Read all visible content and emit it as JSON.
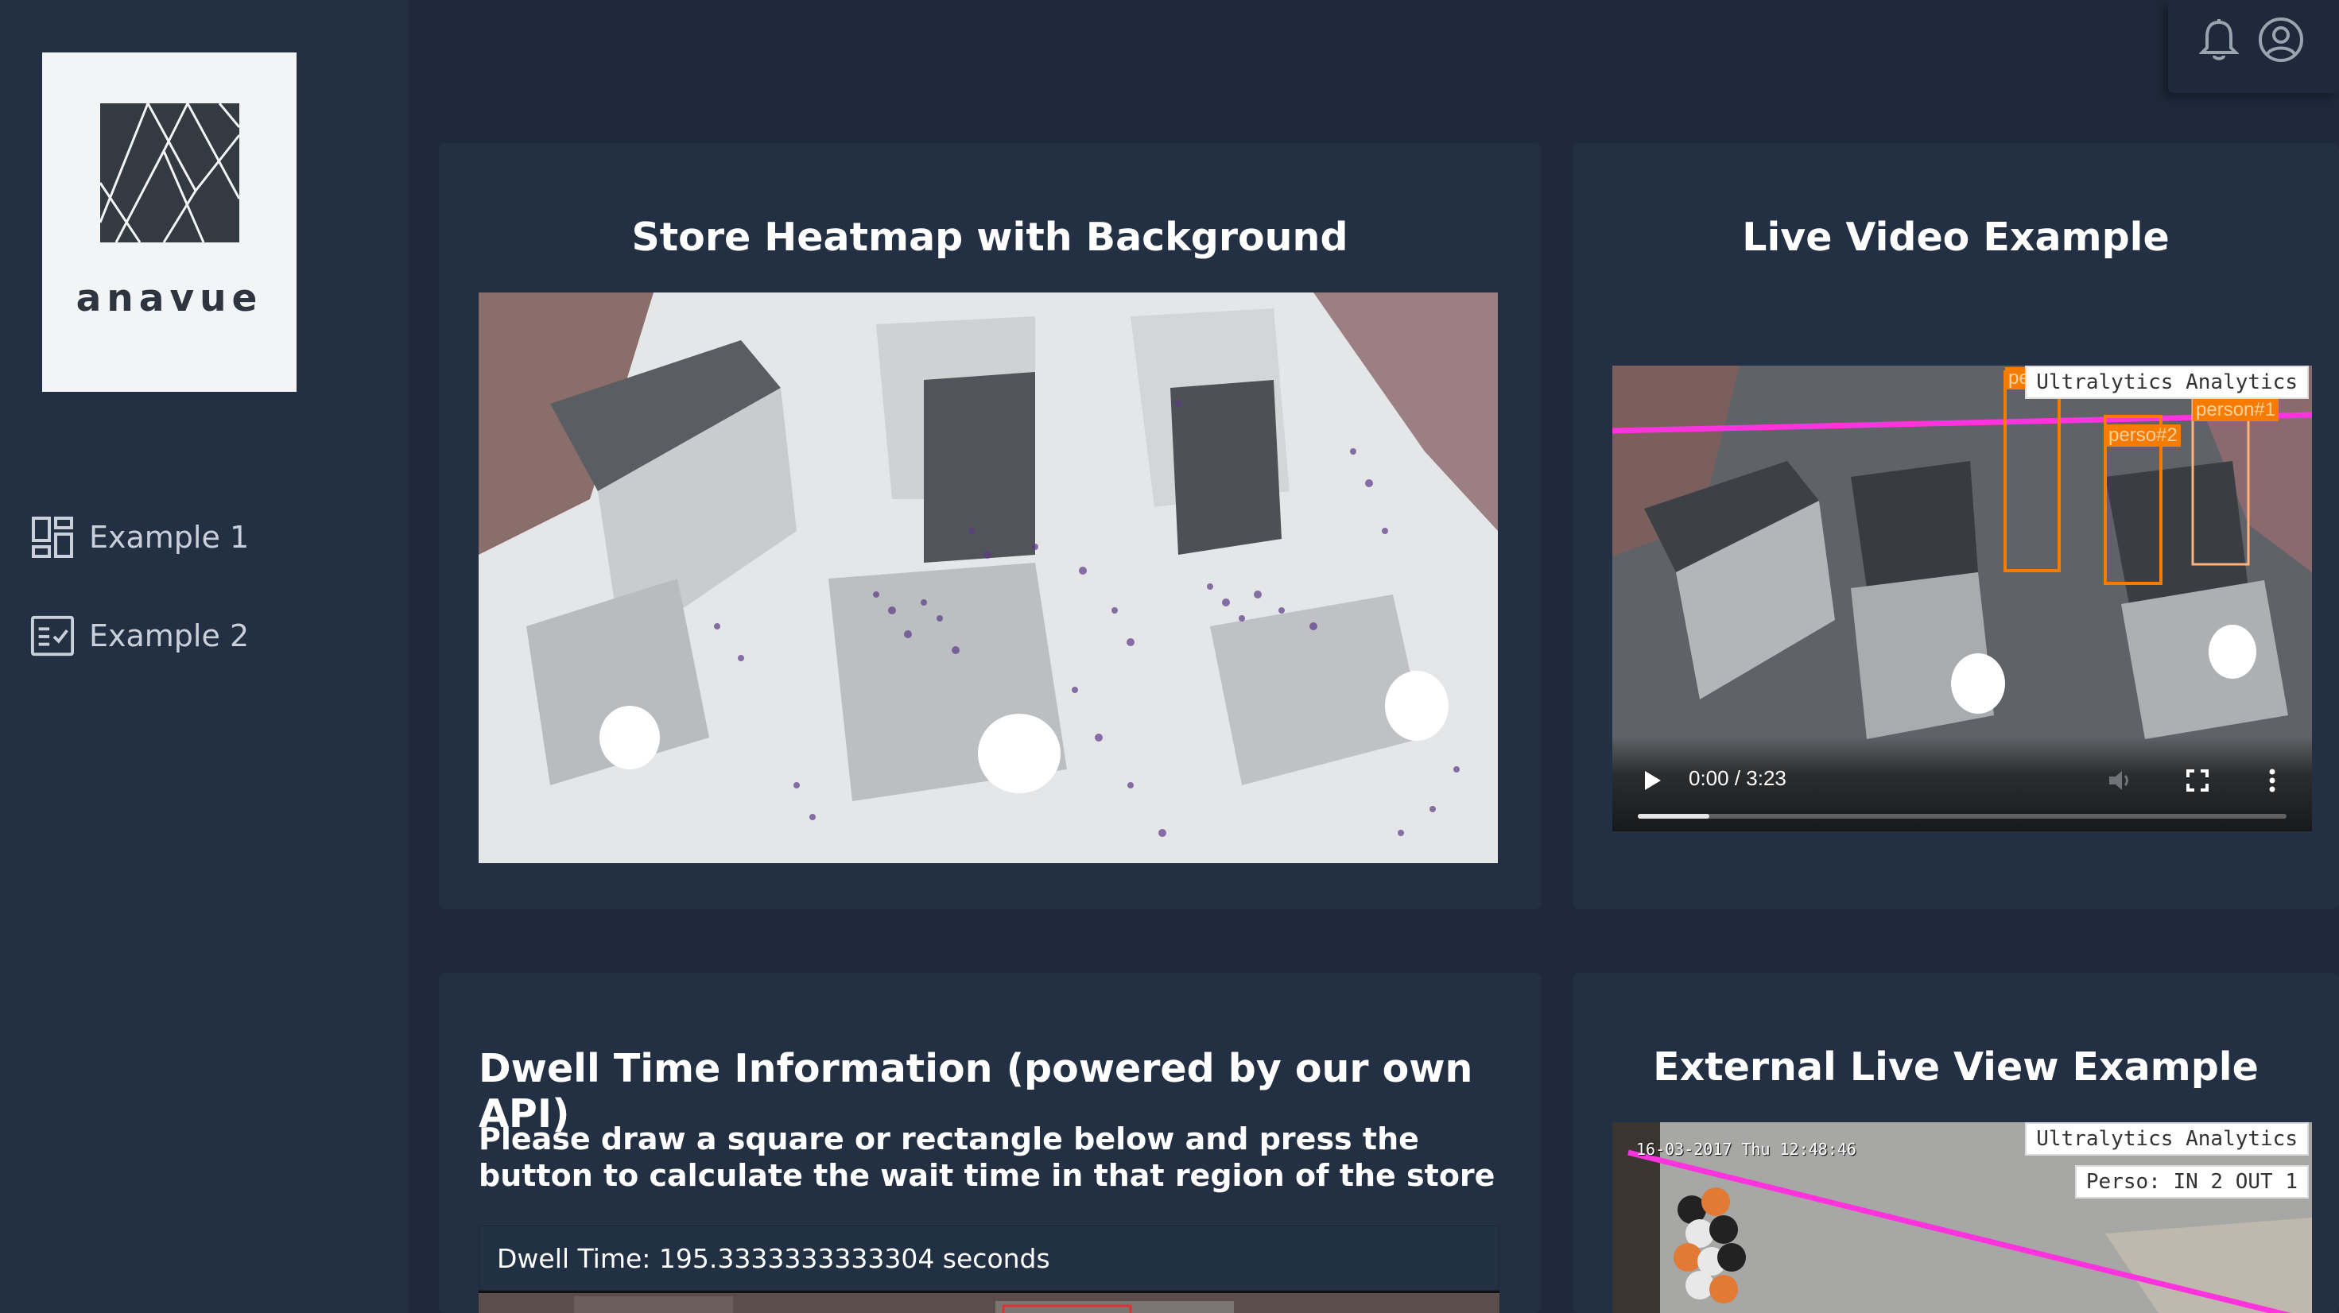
{
  "brand": {
    "name": "anavue"
  },
  "sidebar": {
    "items": [
      {
        "label": "Example 1",
        "icon": "dashboard-icon"
      },
      {
        "label": "Example 2",
        "icon": "checklist-icon"
      }
    ]
  },
  "header": {
    "icons": [
      "bell-icon",
      "user-circle-icon"
    ]
  },
  "cards": {
    "heatmap": {
      "title": "Store Heatmap with Background"
    },
    "live_video": {
      "title": "Live Video Example",
      "overlay_label": "Ultralytics Analytics",
      "detections": [
        "perso",
        "person#1",
        "perso#2"
      ],
      "time": "0:00 / 3:23",
      "progress": 0.11
    },
    "dwell": {
      "title": "Dwell Time Information (powered by our own API)",
      "description": "Please draw a square or rectangle below and press the button to calculate the wait time in that region of the store",
      "result": "Dwell Time: 195.3333333333304 seconds"
    },
    "external": {
      "title": "External Live View Example",
      "overlay_label": "Ultralytics Analytics",
      "counter": "Perso: IN 2 OUT 1",
      "timestamp": "16-03-2017 Thu 12:48:46"
    }
  },
  "colors": {
    "background": "#1e293b",
    "panel": "#233044",
    "line_magenta": "#ff33dd",
    "box_orange": "#f57c00"
  }
}
